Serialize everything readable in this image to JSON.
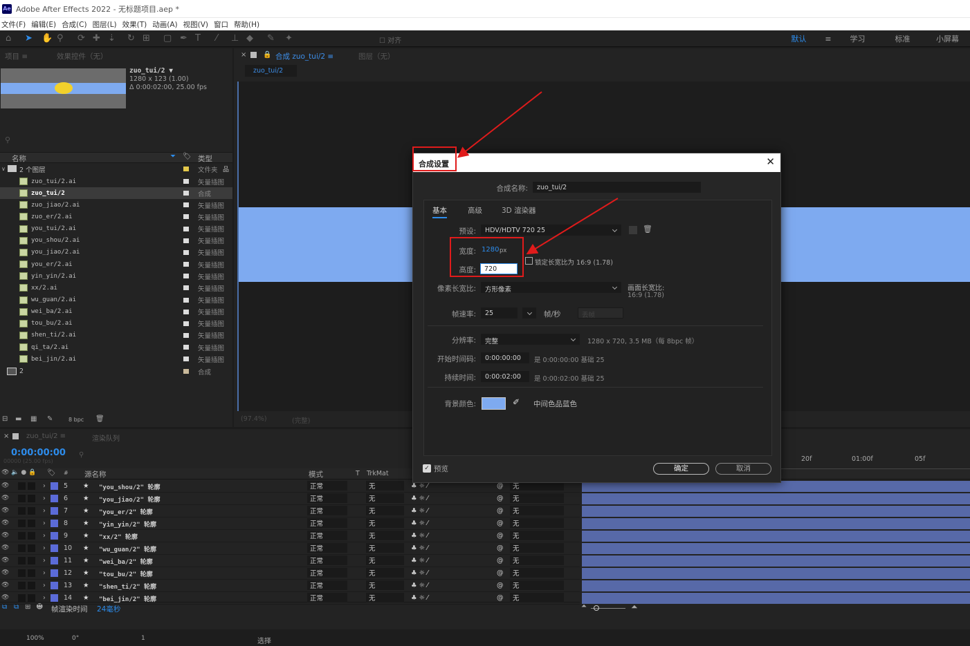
{
  "app": {
    "logo": "Ae",
    "title": "Adobe After Effects 2022 - 无标题项目.aep *"
  },
  "menu": [
    "文件(F)",
    "编辑(E)",
    "合成(C)",
    "图层(L)",
    "效果(T)",
    "动画(A)",
    "视图(V)",
    "窗口",
    "帮助(H)"
  ],
  "toolbar": {
    "snap_label": "对齐",
    "workspaces": [
      "默认",
      "≡",
      "学习",
      "标准",
      "小屏幕"
    ],
    "active_workspace": "默认"
  },
  "project_panel": {
    "tab_project": "项目 ≡",
    "tab_effects": "效果控件（无）",
    "comp_name": "zuo_tui/2 ▼",
    "comp_size": "1280 x 123 (1.00)",
    "comp_duration": "Δ 0:00:02:00, 25.00 fps",
    "col_name": "名称",
    "col_type": "类型",
    "folder": {
      "name": "2 个图层",
      "type": "文件夹"
    },
    "items": [
      {
        "name": "zuo_tui/2.ai",
        "type": "矢量插图"
      },
      {
        "name": "zuo_tui/2",
        "type": "合成",
        "selected": true
      },
      {
        "name": "zuo_jiao/2.ai",
        "type": "矢量插图"
      },
      {
        "name": "zuo_er/2.ai",
        "type": "矢量插图"
      },
      {
        "name": "you_tui/2.ai",
        "type": "矢量插图"
      },
      {
        "name": "you_shou/2.ai",
        "type": "矢量插图"
      },
      {
        "name": "you_jiao/2.ai",
        "type": "矢量插图"
      },
      {
        "name": "you_er/2.ai",
        "type": "矢量插图"
      },
      {
        "name": "yin_yin/2.ai",
        "type": "矢量插图"
      },
      {
        "name": "xx/2.ai",
        "type": "矢量插图"
      },
      {
        "name": "wu_guan/2.ai",
        "type": "矢量插图"
      },
      {
        "name": "wei_ba/2.ai",
        "type": "矢量插图"
      },
      {
        "name": "tou_bu/2.ai",
        "type": "矢量插图"
      },
      {
        "name": "shen_ti/2.ai",
        "type": "矢量插图"
      },
      {
        "name": "qi_ta/2.ai",
        "type": "矢量插图"
      },
      {
        "name": "bei_jin/2.ai",
        "type": "矢量插图"
      }
    ],
    "comp2": {
      "name": "2",
      "type": "合成"
    },
    "bpc": "8 bpc"
  },
  "comp_panel": {
    "tab_label": "合成 zuo_tui/2 ≡",
    "layer_tab": "图层（无）",
    "breadcrumb": "zuo_tui/2",
    "zoom": "(97.4%)",
    "quality": "(完整)"
  },
  "timeline": {
    "tab_comp": "zuo_tui/2 ≡",
    "tab_render": "渲染队列",
    "timecode": "0:00:00:00",
    "frame_info": "00000 (25.00 fps)",
    "col_source": "源名称",
    "col_mode": "模式",
    "col_t": "T",
    "col_trkmat": "TrkMat",
    "ruler": [
      "20f",
      "01:00f",
      "05f"
    ],
    "layers": [
      {
        "num": "5",
        "name": "\"you_shou/2\" 轮廓",
        "mode": "正常",
        "trk": "无",
        "parent": "无"
      },
      {
        "num": "6",
        "name": "\"you_jiao/2\" 轮廓",
        "mode": "正常",
        "trk": "无",
        "parent": "无"
      },
      {
        "num": "7",
        "name": "\"you_er/2\" 轮廓",
        "mode": "正常",
        "trk": "无",
        "parent": "无"
      },
      {
        "num": "8",
        "name": "\"yin_yin/2\" 轮廓",
        "mode": "正常",
        "trk": "无",
        "parent": "无"
      },
      {
        "num": "9",
        "name": "\"xx/2\" 轮廓",
        "mode": "正常",
        "trk": "无",
        "parent": "无"
      },
      {
        "num": "10",
        "name": "\"wu_guan/2\" 轮廓",
        "mode": "正常",
        "trk": "无",
        "parent": "无"
      },
      {
        "num": "11",
        "name": "\"wei_ba/2\" 轮廓",
        "mode": "正常",
        "trk": "无",
        "parent": "无"
      },
      {
        "num": "12",
        "name": "\"tou_bu/2\" 轮廓",
        "mode": "正常",
        "trk": "无",
        "parent": "无"
      },
      {
        "num": "13",
        "name": "\"shen_ti/2\" 轮廓",
        "mode": "正常",
        "trk": "无",
        "parent": "无"
      },
      {
        "num": "14",
        "name": "\"bei_jin/2\" 轮廓",
        "mode": "正常",
        "trk": "无",
        "parent": "无"
      }
    ],
    "render_time_label": "帧渲染时间",
    "render_time": "24毫秒",
    "footer_zoom": "100%",
    "footer_angle": "0°",
    "footer_num": "1",
    "footer_select": "选择"
  },
  "dialog": {
    "title": "合成设置",
    "comp_name_label": "合成名称:",
    "comp_name": "zuo_tui/2",
    "tabs": [
      "基本",
      "高级",
      "3D 渲染器"
    ],
    "preset_label": "预设:",
    "preset": "HDV/HDTV 720 25",
    "width_label": "宽度:",
    "width": "1280",
    "width_unit": "px",
    "height_label": "高度:",
    "height": "720",
    "lock_label": "锁定长宽比为 16:9 (1.78)",
    "par_label": "像素长宽比:",
    "par": "方形像素",
    "frame_ar_label": "画面长宽比:",
    "frame_ar": "16:9 (1.78)",
    "fps_label": "帧速率:",
    "fps": "25",
    "fps_unit": "帧/秒",
    "drop_frame": "丢帧",
    "res_label": "分辨率:",
    "res": "完整",
    "res_info": "1280 x 720, 3.5 MB（每 8bpc 帧）",
    "start_label": "开始时间码:",
    "start": "0:00:00:00",
    "start_note": "是 0:00:00:00  基础 25",
    "dur_label": "持续时间:",
    "dur": "0:00:02:00",
    "dur_note": "是 0:00:02:00  基础 25",
    "bg_label": "背景颜色:",
    "bg_color": "#7eaaf0",
    "bg_name": "中间色品蓝色",
    "preview_label": "预览",
    "ok": "确定",
    "cancel": "取消"
  }
}
